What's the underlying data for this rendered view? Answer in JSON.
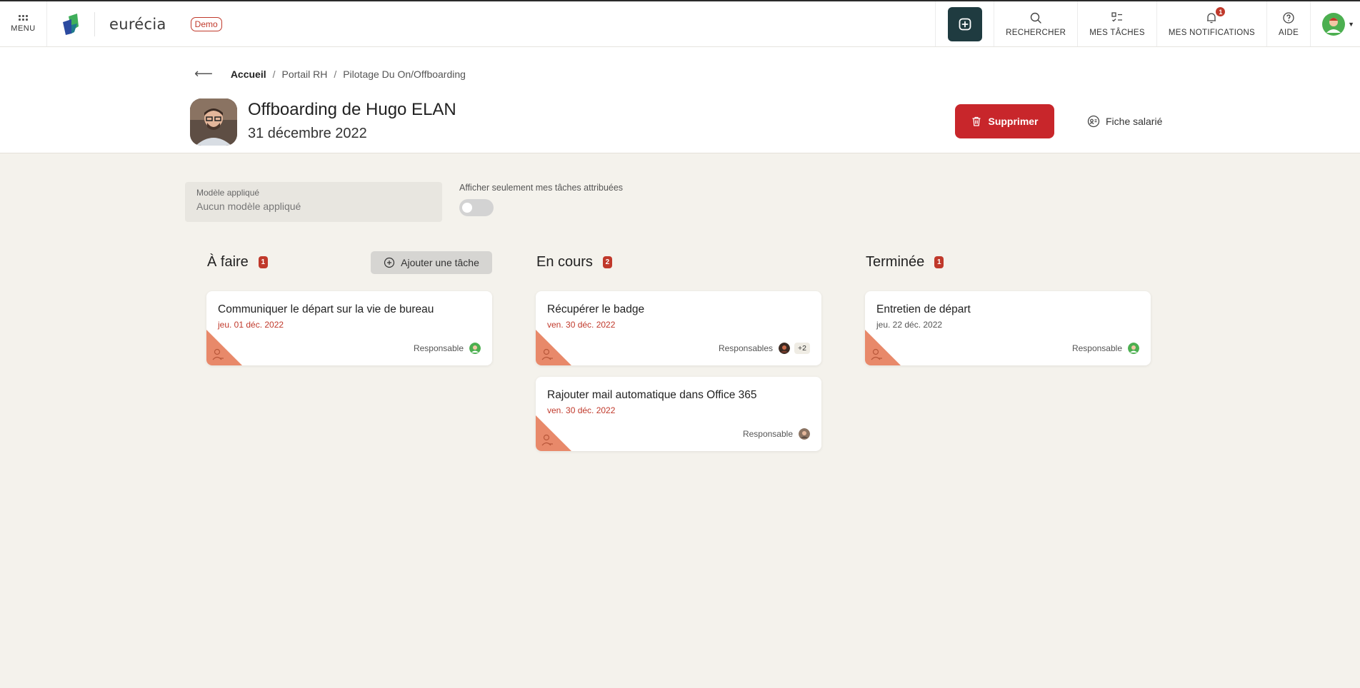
{
  "topbar": {
    "menu_label": "MENU",
    "brand": "eurécia",
    "demo_badge": "Demo",
    "nav": {
      "search": "RECHERCHER",
      "tasks": "MES TÂCHES",
      "notifications": "MES NOTIFICATIONS",
      "notifications_count": "1",
      "help": "AIDE"
    }
  },
  "breadcrumb": {
    "home": "Accueil",
    "portal": "Portail RH",
    "current": "Pilotage Du On/Offboarding"
  },
  "header": {
    "title": "Offboarding de Hugo ELAN",
    "date": "31 décembre 2022",
    "delete_label": "Supprimer",
    "employee_file_label": "Fiche salarié"
  },
  "filters": {
    "model_label": "Modèle appliqué",
    "model_value": "Aucun modèle appliqué",
    "toggle_label": "Afficher seulement mes tâches attribuées",
    "toggle_on": false
  },
  "columns": [
    {
      "title": "À faire",
      "count": "1",
      "add_task_label": "Ajouter une tâche",
      "cards": [
        {
          "title": "Communiquer le départ sur la vie de bureau",
          "date": "jeu. 01 déc. 2022",
          "responsible_label": "Responsable"
        }
      ]
    },
    {
      "title": "En cours",
      "count": "2",
      "cards": [
        {
          "title": "Récupérer le badge",
          "date": "ven. 30 déc. 2022",
          "responsible_label": "Responsables",
          "extra": "+2"
        },
        {
          "title": "Rajouter mail automatique dans Office 365",
          "date": "ven. 30 déc. 2022",
          "responsible_label": "Responsable"
        }
      ]
    },
    {
      "title": "Terminée",
      "count": "1",
      "cards": [
        {
          "title": "Entretien de départ",
          "date": "jeu. 22 déc. 2022",
          "responsible_label": "Responsable"
        }
      ]
    }
  ],
  "colors": {
    "accent_red": "#c8262b",
    "dark_teal": "#1f3b40",
    "corner_salmon": "#e8896a",
    "background": "#f4f2ec"
  }
}
